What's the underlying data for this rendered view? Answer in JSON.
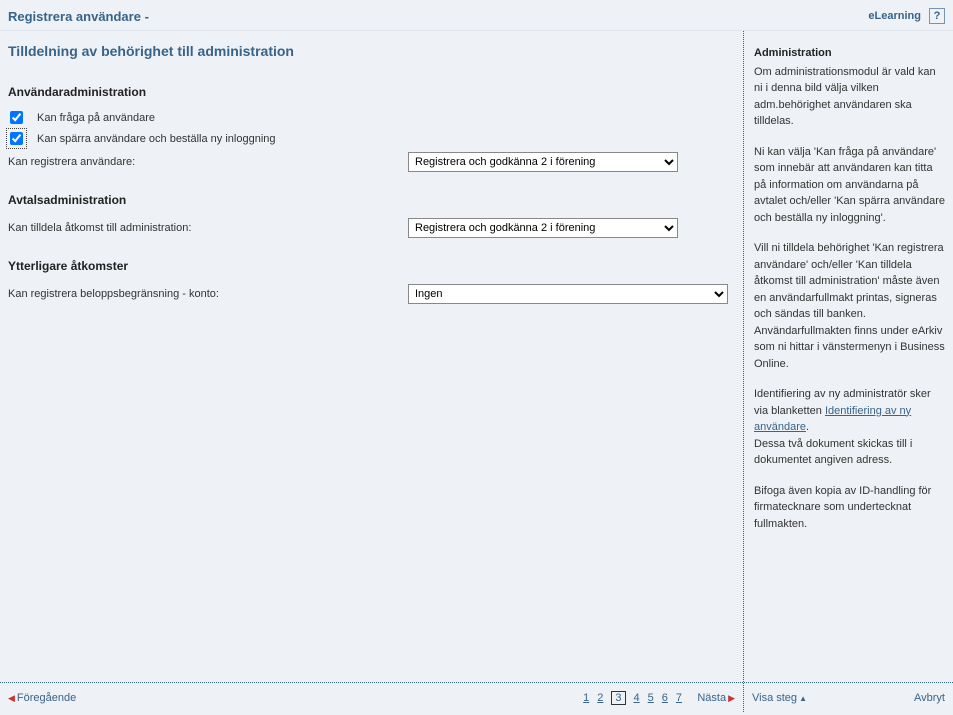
{
  "header": {
    "title": "Registrera användare -",
    "elearning": "eLearning",
    "help": "?"
  },
  "main": {
    "page_title": "Tilldelning av behörighet till administration",
    "user_admin": {
      "heading": "Användaradministration",
      "cb1_label": "Kan fråga på användare",
      "cb2_label": "Kan spärra användare och beställa ny inloggning",
      "reg_label": "Kan registrera användare:",
      "reg_value": "Registrera och godkänna 2 i förening"
    },
    "agreement_admin": {
      "heading": "Avtalsadministration",
      "access_label": "Kan tilldela åtkomst till administration:",
      "access_value": "Registrera och godkänna 2 i förening"
    },
    "additional": {
      "heading": "Ytterligare åtkomster",
      "limit_label": "Kan registrera beloppsbegränsning - konto:",
      "limit_value": "Ingen"
    }
  },
  "side": {
    "heading": "Administration",
    "p1": "Om administrationsmodul är vald kan ni i denna bild välja vilken adm.behörighet användaren ska tilldelas.",
    "p2": "Ni kan välja 'Kan fråga på användare' som innebär att användaren kan titta på information om användarna på avtalet och/eller 'Kan spärra användare och beställa ny inloggning'.",
    "p3a": "Vill ni tilldela behörighet 'Kan registrera användare' och/eller 'Kan tilldela åtkomst till administration' måste även en användarfullmakt printas, signeras och sändas till banken.",
    "p3b": "Användarfullmakten finns under eArkiv som ni hittar i vänstermenyn i Business Online.",
    "p4a": "Identifiering av ny administratör sker via blanketten ",
    "p4_link": "Identifiering av ny användare",
    "p4b": ".",
    "p4c": "Dessa två dokument skickas till i dokumentet angiven adress.",
    "p5": "Bifoga även kopia av ID-handling för firmatecknare som undertecknat fullmakten."
  },
  "footer": {
    "prev": "Föregående",
    "next": "Nästa",
    "steps": [
      "1",
      "2",
      "3",
      "4",
      "5",
      "6",
      "7"
    ],
    "current_step": "3",
    "show_steps": "Visa steg",
    "cancel": "Avbryt"
  }
}
